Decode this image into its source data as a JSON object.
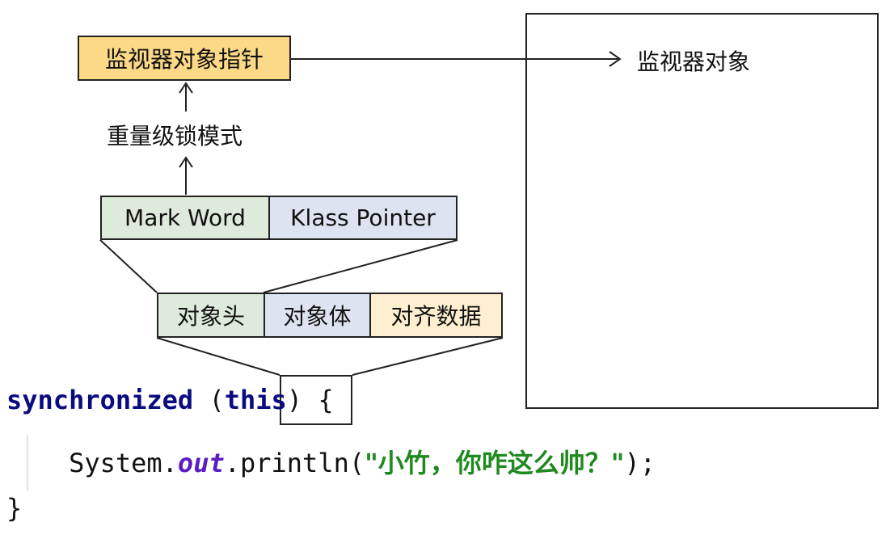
{
  "monitor_pointer": "监视器对象指针",
  "monitor_object": "监视器对象",
  "heavyweight_mode": "重量级锁模式",
  "mark_word": "Mark Word",
  "klass_pointer": "Klass Pointer",
  "object_header": "对象头",
  "object_body": "对象体",
  "alignment_padding": "对齐数据",
  "code": {
    "line1_kw": "synchronized",
    "line1_open": " (",
    "line1_this": "this",
    "line1_close": ") {",
    "line2_indent": "    ",
    "line2_system": "System.",
    "line2_out": "out",
    "line2_println": ".println(",
    "line2_string": "\"小竹，你咋这么帅？\"",
    "line2_end": ");",
    "line3": "}"
  },
  "colors": {
    "pointer_fill": "#fcd986",
    "mark_word_fill": "#deeadb",
    "klass_fill": "#dde3f1",
    "header_fill": "#deeadb",
    "body_fill": "#dde3f1",
    "padding_fill": "#fdefcf"
  },
  "icons": [
    "arrow-up-icon",
    "arrow-right-icon"
  ]
}
